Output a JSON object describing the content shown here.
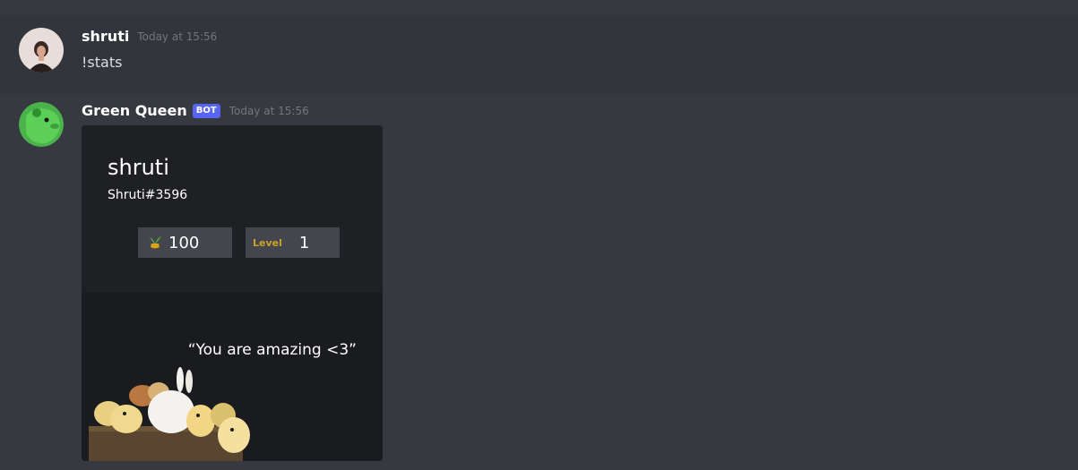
{
  "messages": [
    {
      "author": "shruti",
      "timestamp": "Today at 15:56",
      "content": "!stats"
    },
    {
      "author": "Green Queen",
      "bot_tag": "BOT",
      "timestamp": "Today at 15:56"
    }
  ],
  "card": {
    "name": "shruti",
    "tag": "Shruti#3596",
    "coins": "100",
    "level_label": "Level",
    "level": "1",
    "quote": "“You are amazing <3”",
    "coin_icon": "sprout-coin-icon"
  },
  "colors": {
    "background": "#36393f",
    "highlight_row": "#32353b",
    "bot_tag": "#5865f2",
    "level_label": "#c9a227"
  }
}
